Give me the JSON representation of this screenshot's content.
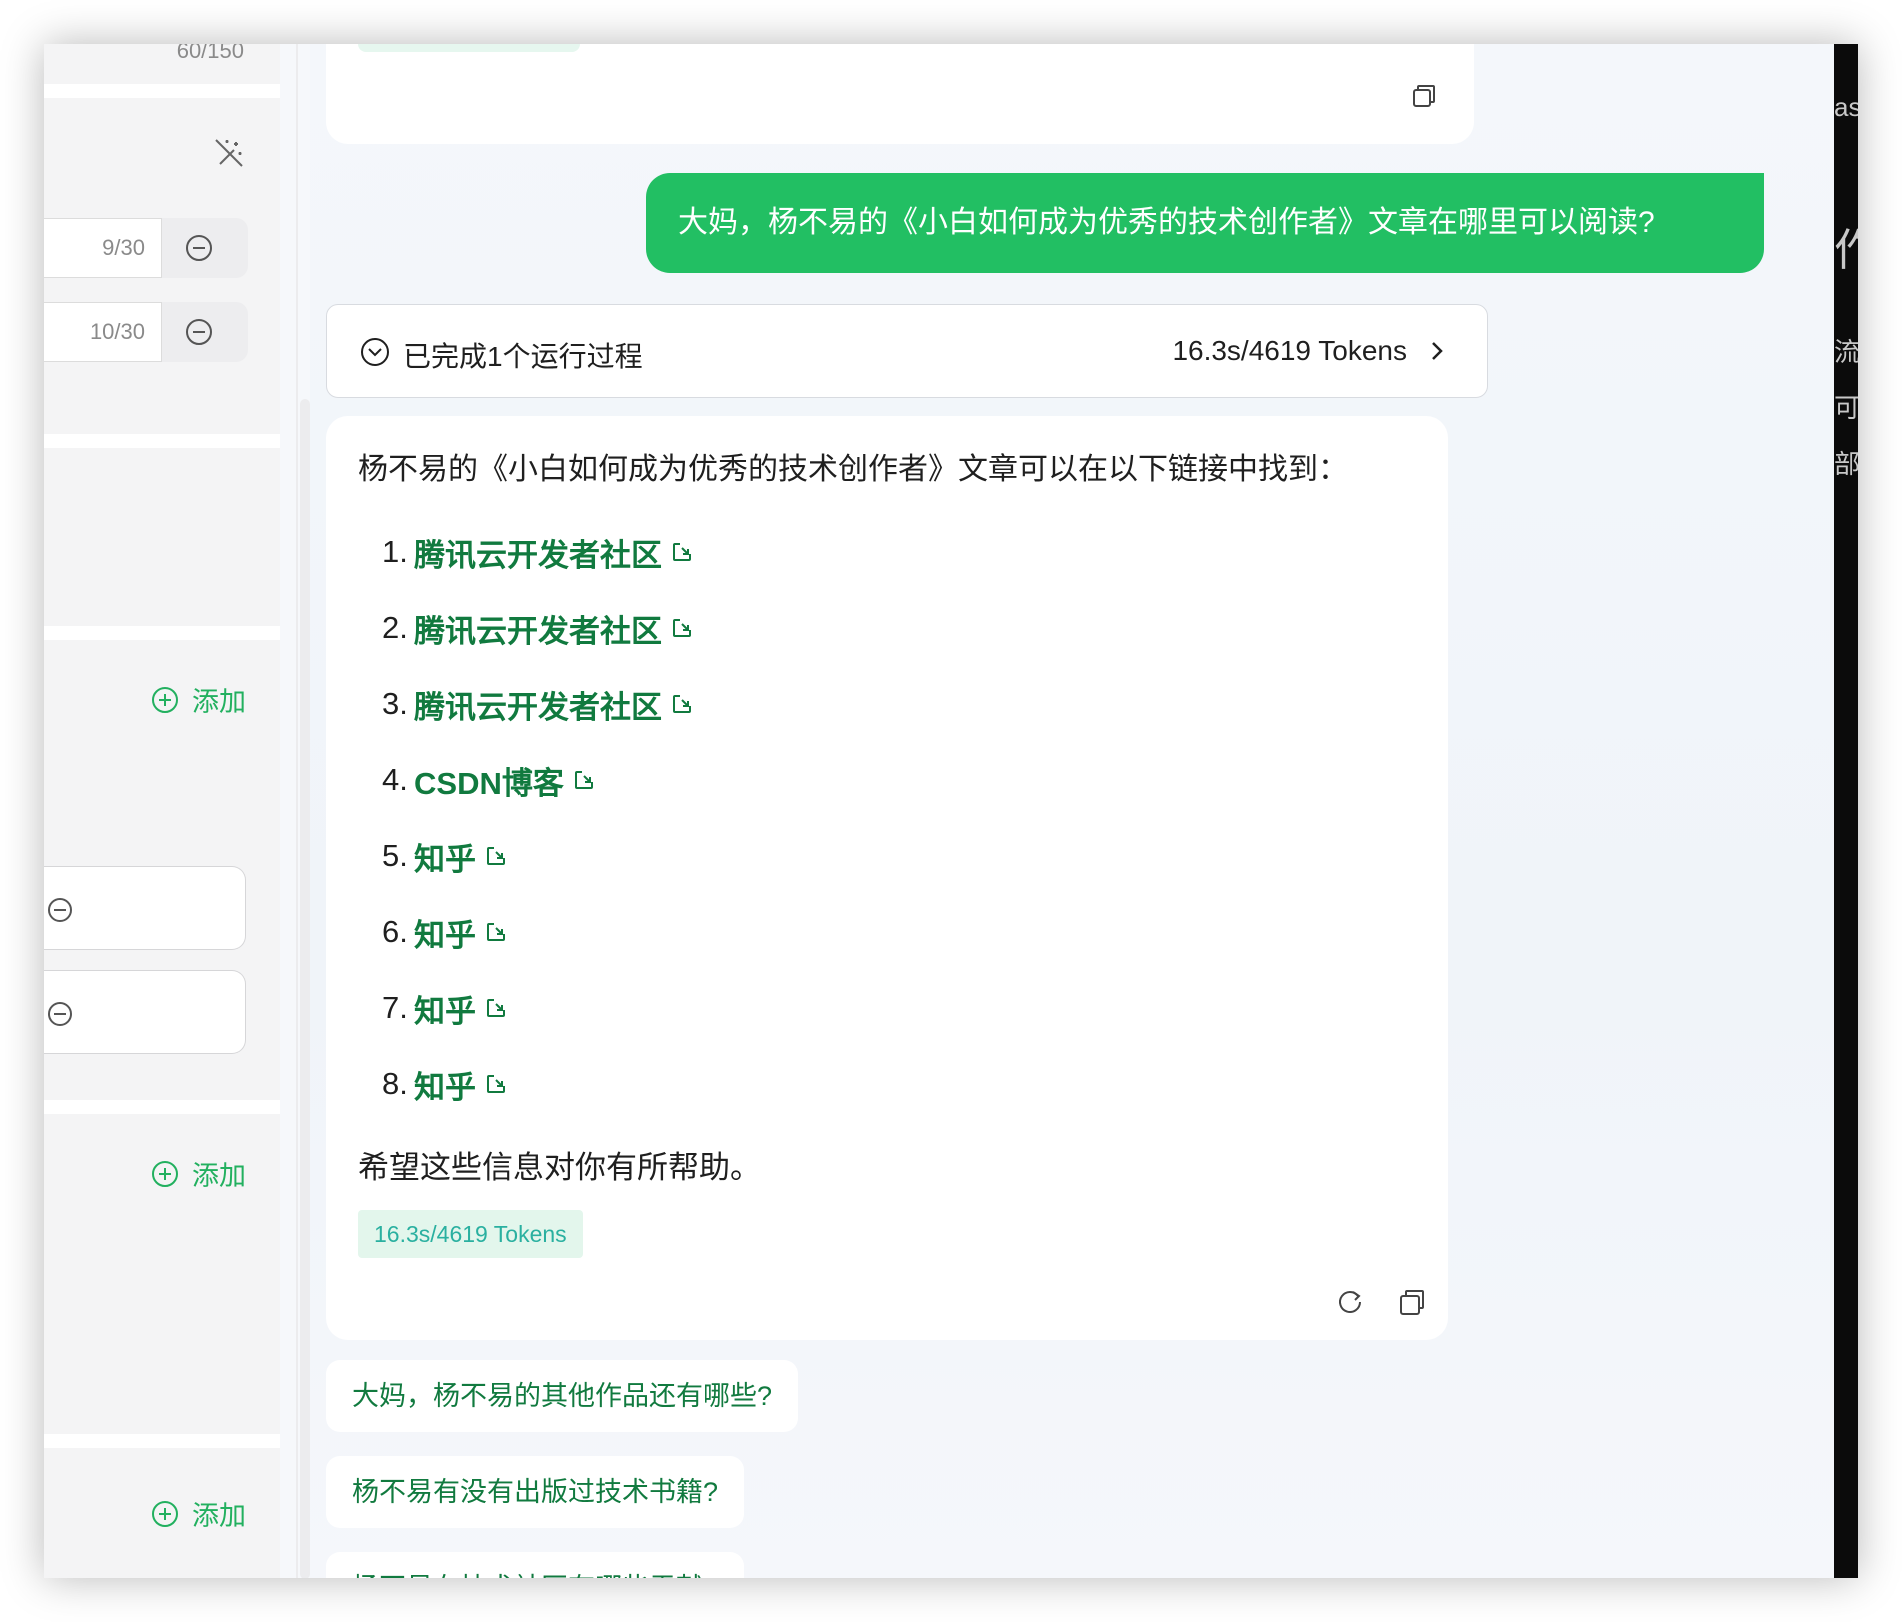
{
  "left_panel": {
    "top_counter": "60/150",
    "counters": [
      "9/30",
      "10/30"
    ],
    "add_label": "添加"
  },
  "chat": {
    "user_message": "大妈，杨不易的《小白如何成为优秀的技术创作者》文章在哪里可以阅读?",
    "run_summary": {
      "label": "已完成1个运行过程",
      "stats": "16.3s/4619 Tokens"
    },
    "answer": {
      "intro": "杨不易的《小白如何成为优秀的技术创作者》文章可以在以下链接中找到：",
      "links": [
        {
          "num": "1.",
          "label": "腾讯云开发者社区"
        },
        {
          "num": "2.",
          "label": "腾讯云开发者社区"
        },
        {
          "num": "3.",
          "label": "腾讯云开发者社区"
        },
        {
          "num": "4.",
          "label": "CSDN博客"
        },
        {
          "num": "5.",
          "label": "知乎"
        },
        {
          "num": "6.",
          "label": "知乎"
        },
        {
          "num": "7.",
          "label": "知乎"
        },
        {
          "num": "8.",
          "label": "知乎"
        }
      ],
      "outro": "希望这些信息对你有所帮助。",
      "token_tag": "16.3s/4619 Tokens"
    },
    "suggestions": [
      "大妈，杨不易的其他作品还有哪些?",
      "杨不易有没有出版过技术书籍?",
      "杨不易在技术社区有哪些贡献?"
    ]
  },
  "right_edge_fragments": [
    "as",
    "作",
    "流",
    "可",
    "部"
  ],
  "colors": {
    "accent_green": "#22bf63",
    "link_green": "#117a3f",
    "token_teal": "#2ab0a0"
  },
  "icons": [
    "magic-wand-off-icon",
    "minus-circle-icon",
    "plus-circle-icon",
    "copy-icon",
    "refresh-icon",
    "chevron-down-circle-icon",
    "chevron-right-icon",
    "external-link-icon"
  ]
}
